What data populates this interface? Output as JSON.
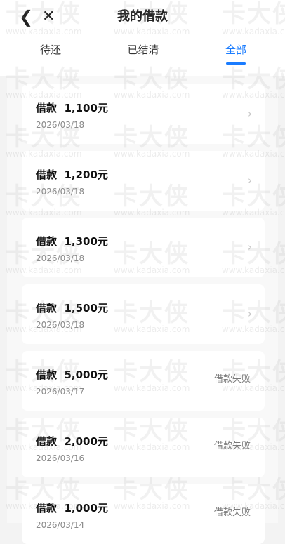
{
  "header": {
    "back_icon": "chevron-left-icon",
    "close_icon": "close-icon",
    "title": "我的借款"
  },
  "tabs": [
    {
      "label": "待还",
      "active": false
    },
    {
      "label": "已结清",
      "active": false
    },
    {
      "label": "全部",
      "active": true
    }
  ],
  "colors": {
    "accent": "#1a7cff",
    "background": "#f3f3f3",
    "card": "#ffffff"
  },
  "loans": [
    {
      "title_prefix": "借款",
      "amount": "1,100元",
      "date": "2026/03/18",
      "status": "",
      "arrow": "›"
    },
    {
      "title_prefix": "借款",
      "amount": "1,200元",
      "date": "2026/03/18",
      "status": "",
      "arrow": "›"
    },
    {
      "title_prefix": "借款",
      "amount": "1,300元",
      "date": "2026/03/18",
      "status": "",
      "arrow": "›"
    },
    {
      "title_prefix": "借款",
      "amount": "1,500元",
      "date": "2026/03/18",
      "status": "",
      "arrow": "›"
    },
    {
      "title_prefix": "借款",
      "amount": "5,000元",
      "date": "2026/03/17",
      "status": "借款失败",
      "arrow": ""
    },
    {
      "title_prefix": "借款",
      "amount": "2,000元",
      "date": "2026/03/16",
      "status": "借款失败",
      "arrow": ""
    },
    {
      "title_prefix": "借款",
      "amount": "1,000元",
      "date": "2026/03/14",
      "status": "借款失败",
      "arrow": ""
    }
  ],
  "watermark": {
    "brand": "卡大侠",
    "site": "www.kadaxia.com"
  }
}
